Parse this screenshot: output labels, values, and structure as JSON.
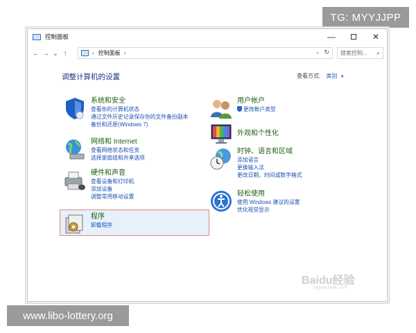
{
  "badges": {
    "telegram": "TG: MYYJJPP",
    "website": "www.libo-lottery.org"
  },
  "window": {
    "title": "控制面板",
    "controls": {
      "minimize": "—",
      "maximize_icon": "maximize-icon",
      "close": "✕"
    }
  },
  "address": {
    "back": "←",
    "forward": "→",
    "recent": "⌄",
    "up": "↑",
    "separator_1": "›",
    "crumb": "控制面板",
    "separator_2": "›",
    "dropdown": "⌄",
    "refresh": "↻",
    "search_placeholder": "搜索控制...",
    "search_icon": "⌕"
  },
  "main": {
    "title": "调整计算机的设置",
    "view_by_label": "查看方式:",
    "view_by_value": "类别",
    "view_by_arrow": "▼"
  },
  "categories_left": [
    {
      "title": "系统和安全",
      "icon": "shield-icon",
      "links": [
        "查看你的计算机状态",
        "通过文件历史记录保存你的文件备份副本",
        "备份和还原(Windows 7)"
      ]
    },
    {
      "title": "网络和 Internet",
      "icon": "globe-icon",
      "links": [
        "查看网络状态和任务",
        "选择家庭组和共享选项"
      ]
    },
    {
      "title": "硬件和声音",
      "icon": "printer-icon",
      "links": [
        "查看设备和打印机",
        "添加设备",
        "调整常用移动设置"
      ]
    },
    {
      "title": "程序",
      "icon": "program-icon",
      "links": [
        "卸载程序"
      ]
    }
  ],
  "categories_right": [
    {
      "title": "用户帐户",
      "icon": "users-icon",
      "links": [
        "更改帐户类型"
      ]
    },
    {
      "title": "外观和个性化",
      "icon": "monitor-icon",
      "links": []
    },
    {
      "title": "时钟、语言和区域",
      "icon": "clock-globe-icon",
      "links": [
        "添加语言",
        "更换输入法",
        "更改日期、时间或数字格式"
      ]
    },
    {
      "title": "轻松使用",
      "icon": "accessibility-icon",
      "links": [
        "使用 Windows 建议的设置",
        "优化视觉显示"
      ]
    }
  ],
  "watermark": {
    "main": "Baidu经验",
    "sub": "jingyan.baidu.com"
  },
  "colors": {
    "title_blue": "#1e3287",
    "category_green": "#1e5f12",
    "link_blue": "#1a4fb5",
    "highlight_bg": "#e7f1fb",
    "highlight_border": "#e08484"
  }
}
